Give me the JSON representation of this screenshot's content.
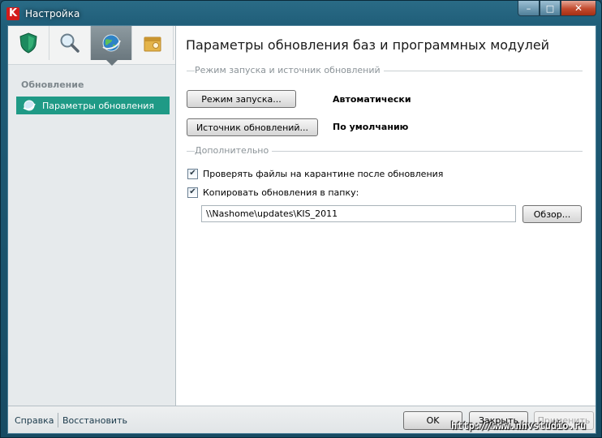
{
  "window": {
    "title": "Настройка",
    "logo_letter": "K",
    "min": "–",
    "max": "□",
    "close": "✕"
  },
  "categories": [
    {
      "name": "protection",
      "icon": "shield-icon"
    },
    {
      "name": "scan",
      "icon": "magnifier-icon"
    },
    {
      "name": "update",
      "icon": "globe-icon",
      "active": true
    },
    {
      "name": "settings",
      "icon": "box-gear-icon"
    }
  ],
  "sidebar": {
    "section": "Обновление",
    "items": [
      {
        "label": "Параметры обновления",
        "selected": true
      }
    ]
  },
  "main": {
    "title": "Параметры обновления баз и программных модулей",
    "group1": "Режим запуска и источник обновлений",
    "run_mode_button": "Режим запуска...",
    "run_mode_value": "Автоматически",
    "source_button": "Источник обновлений...",
    "source_value": "По умолчанию",
    "group2": "Дополнительно",
    "check_quarantine": {
      "label": "Проверять файлы на карантине после обновления",
      "checked": true
    },
    "copy_updates": {
      "label": "Копировать обновления в папку:",
      "checked": true
    },
    "folder_path": "\\\\Nashome\\updates\\KIS_2011",
    "browse_button": "Обзор..."
  },
  "footer": {
    "help": "Справка",
    "restore": "Восстановить",
    "ok": "OK",
    "close": "Закрыть",
    "apply": "Применить"
  },
  "watermark": "http://www.nhvstudio.ru",
  "colors": {
    "accent": "#1f9a86",
    "frame": "#1f5d78"
  }
}
